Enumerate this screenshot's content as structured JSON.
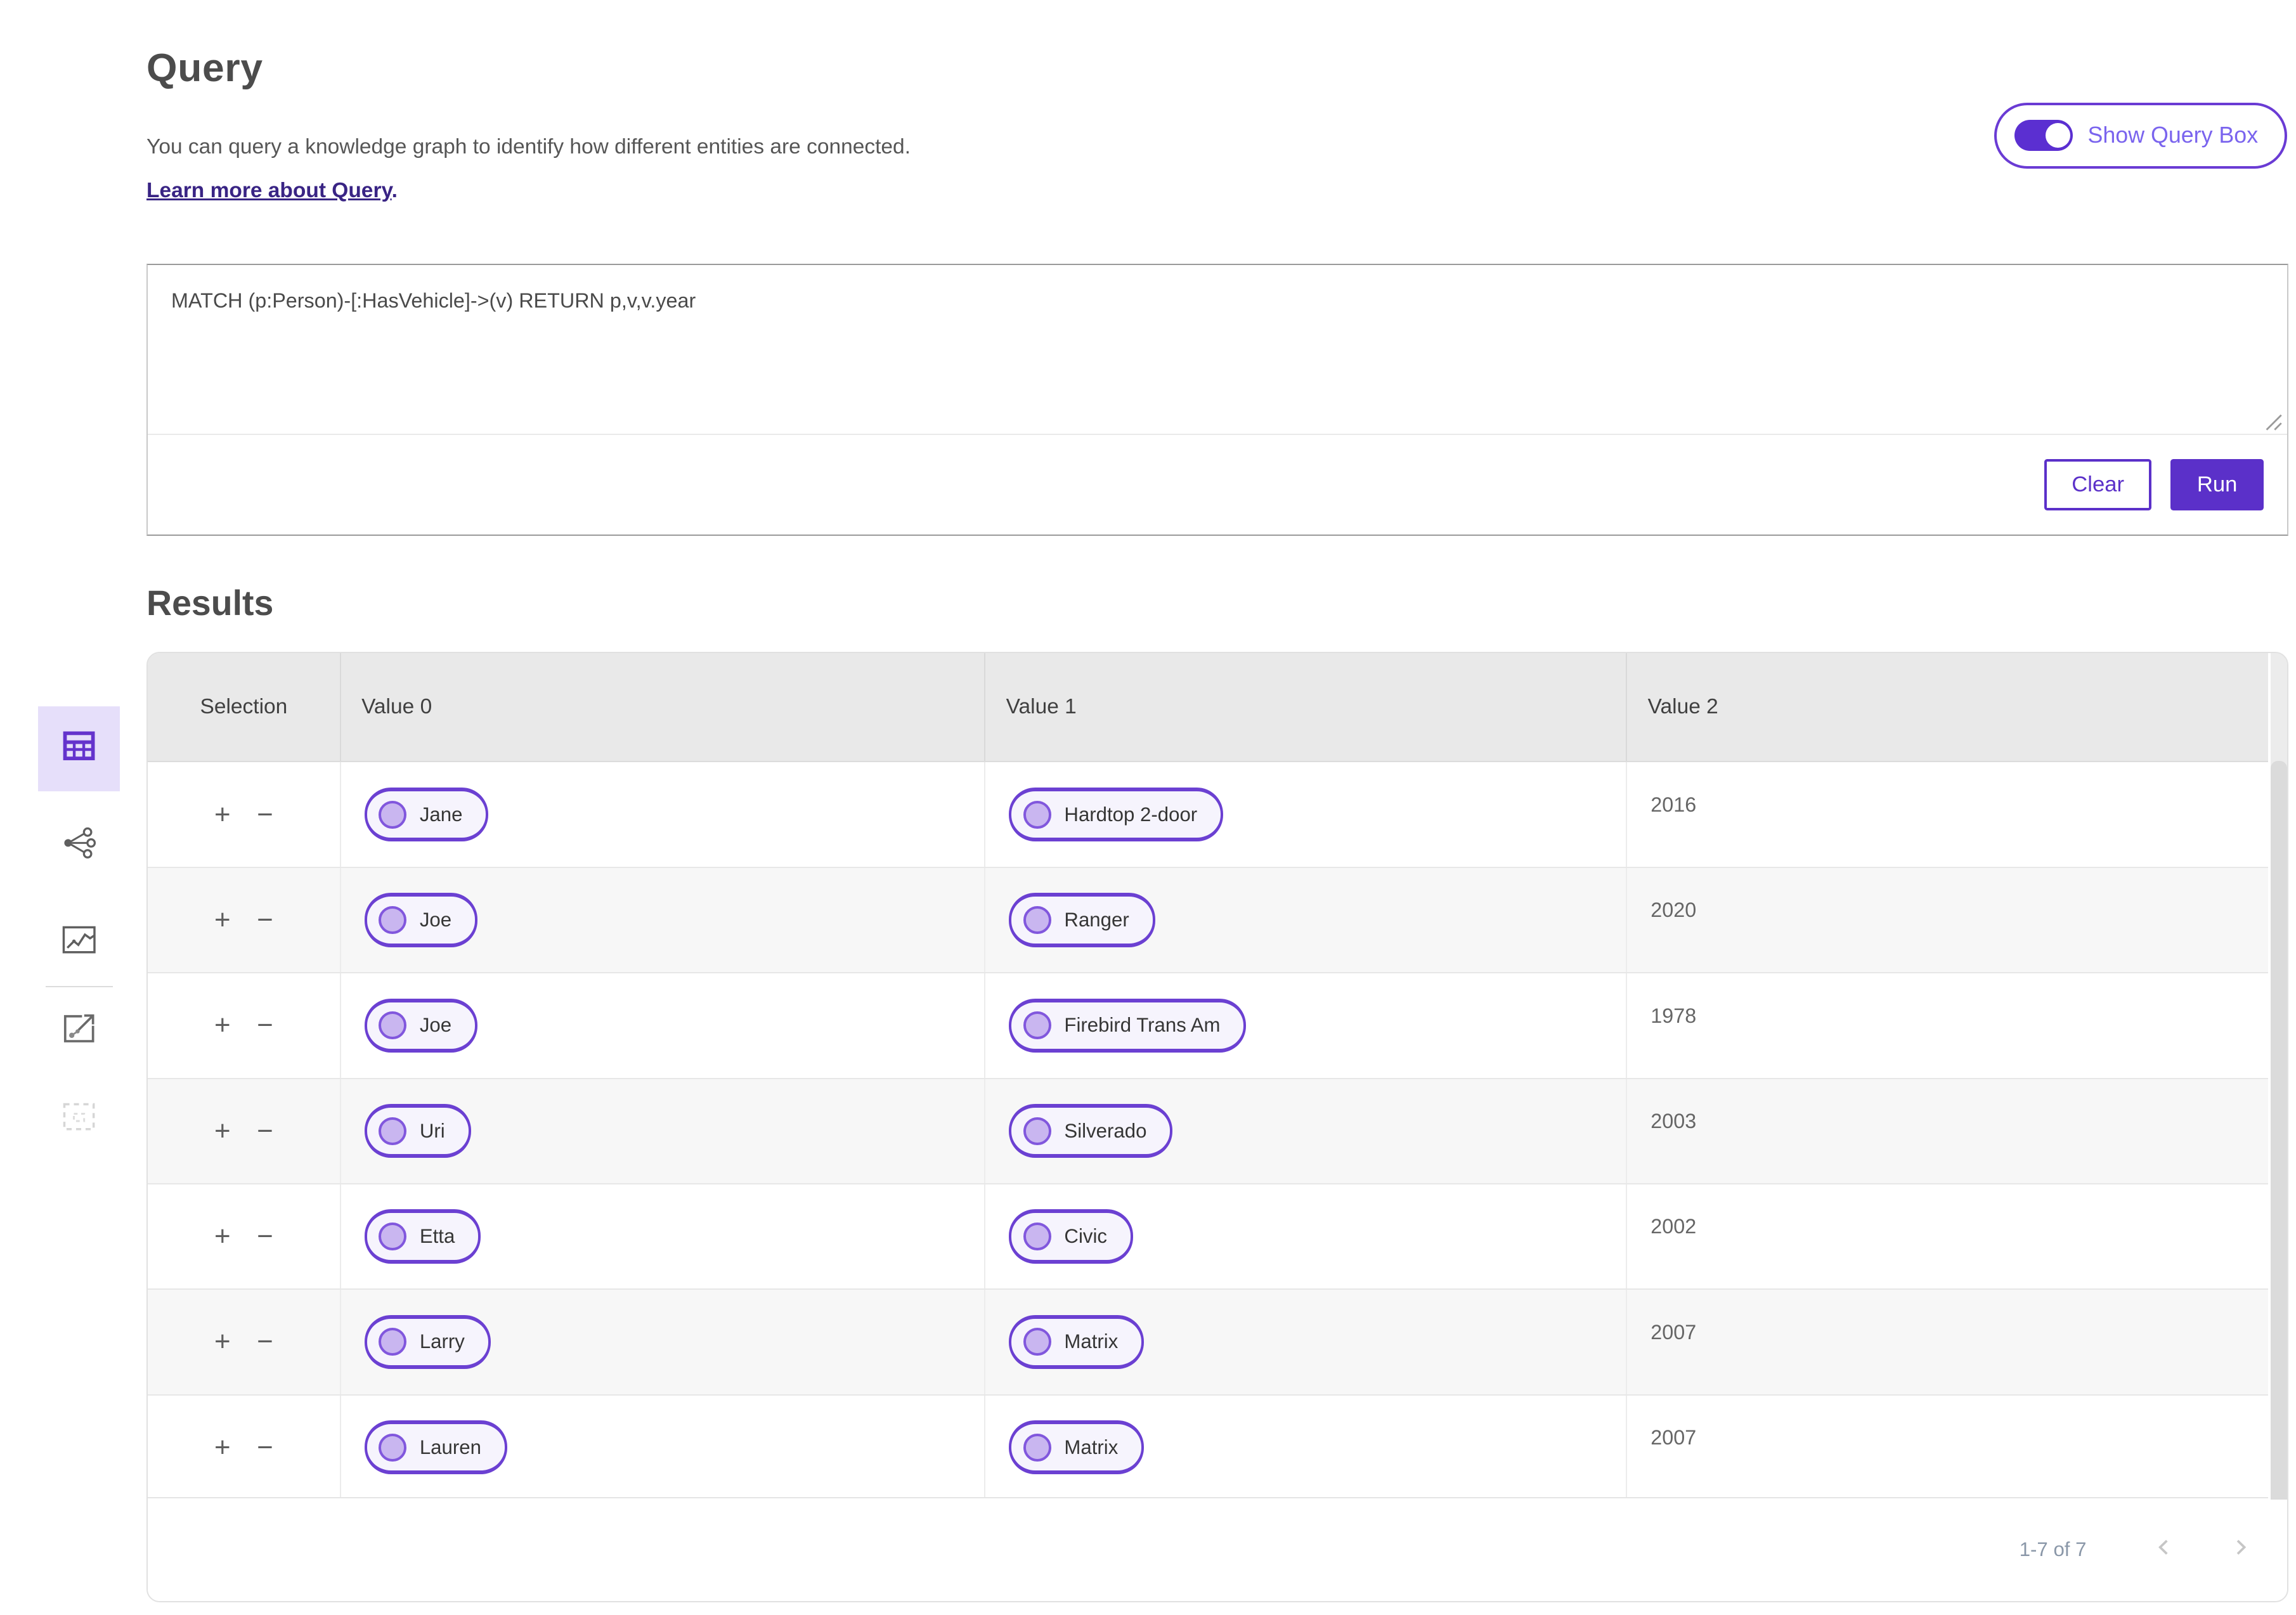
{
  "header": {
    "title": "Query",
    "description": "You can query a knowledge graph to identify how different entities are connected.",
    "learn_more_link": "Learn more about Query",
    "learn_more_suffix": "."
  },
  "toggle": {
    "label": "Show Query Box",
    "state": "on"
  },
  "query_editor": {
    "value": "MATCH (p:Person)-[:HasVehicle]->(v) RETURN p,v,v.year",
    "clear_label": "Clear",
    "run_label": "Run",
    "resize_icon": "resize-grip-icon"
  },
  "results": {
    "title": "Results",
    "columns": [
      "Selection",
      "Value 0",
      "Value 1",
      "Value 2"
    ],
    "row_actions": {
      "add": "+",
      "remove": "−"
    },
    "rows": [
      {
        "value0": "Jane",
        "value1": "Hardtop 2-door",
        "value2": "2016"
      },
      {
        "value0": "Joe",
        "value1": "Ranger",
        "value2": "2020"
      },
      {
        "value0": "Joe",
        "value1": "Firebird Trans Am",
        "value2": "1978"
      },
      {
        "value0": "Uri",
        "value1": "Silverado",
        "value2": "2003"
      },
      {
        "value0": "Etta",
        "value1": "Civic",
        "value2": "2002"
      },
      {
        "value0": "Larry",
        "value1": "Matrix",
        "value2": "2007"
      },
      {
        "value0": "Lauren",
        "value1": "Matrix",
        "value2": "2007"
      }
    ],
    "pagination": {
      "range": "1-7 of 7",
      "prev_icon": "chevron-left-icon",
      "next_icon": "chevron-right-icon"
    }
  },
  "sidebar": {
    "items": [
      {
        "icon": "table-results-icon",
        "selected": true,
        "disabled": false
      },
      {
        "icon": "graph-network-icon",
        "selected": false,
        "disabled": false
      },
      {
        "icon": "map-route-icon",
        "selected": false,
        "disabled": false
      },
      {
        "icon": "graph-export-icon",
        "selected": false,
        "disabled": false
      },
      {
        "icon": "empty-selection-icon",
        "selected": false,
        "disabled": true
      }
    ]
  },
  "colors": {
    "accent_purple": "#5b30c9",
    "pill_border": "#6b40d2",
    "pill_background": "#f6f4fd",
    "node_circle_fill": "#c9b6f0",
    "link_purple": "#392484",
    "toggle_label_purple": "#7a64ee",
    "selected_tile_background": "#e6dffa",
    "table_header_background": "#e9e9e9"
  }
}
